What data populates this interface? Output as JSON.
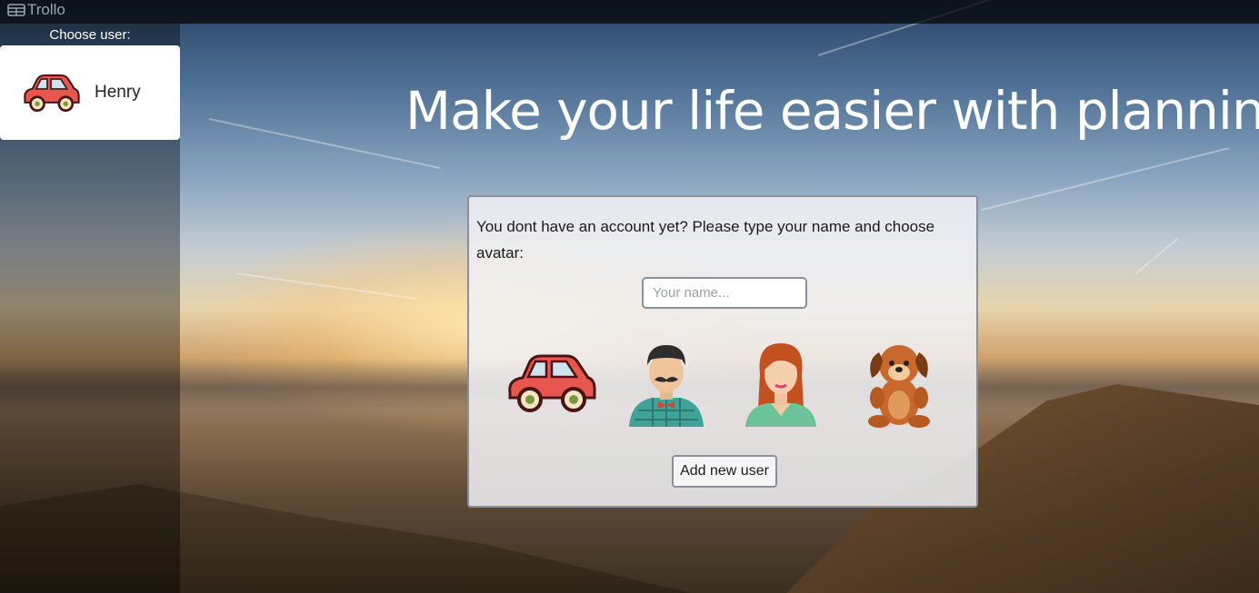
{
  "app": {
    "title": "Trollo",
    "brand_icon": "table-icon"
  },
  "sidebar": {
    "title": "Choose user:",
    "users": [
      {
        "name": "Henry",
        "avatar": "car-icon"
      }
    ]
  },
  "hero": {
    "headline": "Make your life easier with planning"
  },
  "signup": {
    "prompt": "You dont have an account yet? Please type your name and choose avatar:",
    "name_placeholder": "Your name...",
    "name_value": "",
    "avatars": [
      "car-icon",
      "mustache-man-icon",
      "woman-icon",
      "puppy-icon"
    ],
    "add_button_label": "Add new user"
  },
  "colors": {
    "car_red": "#e8574f",
    "panel_border": "#8a9099",
    "text_white": "#ffffff"
  }
}
